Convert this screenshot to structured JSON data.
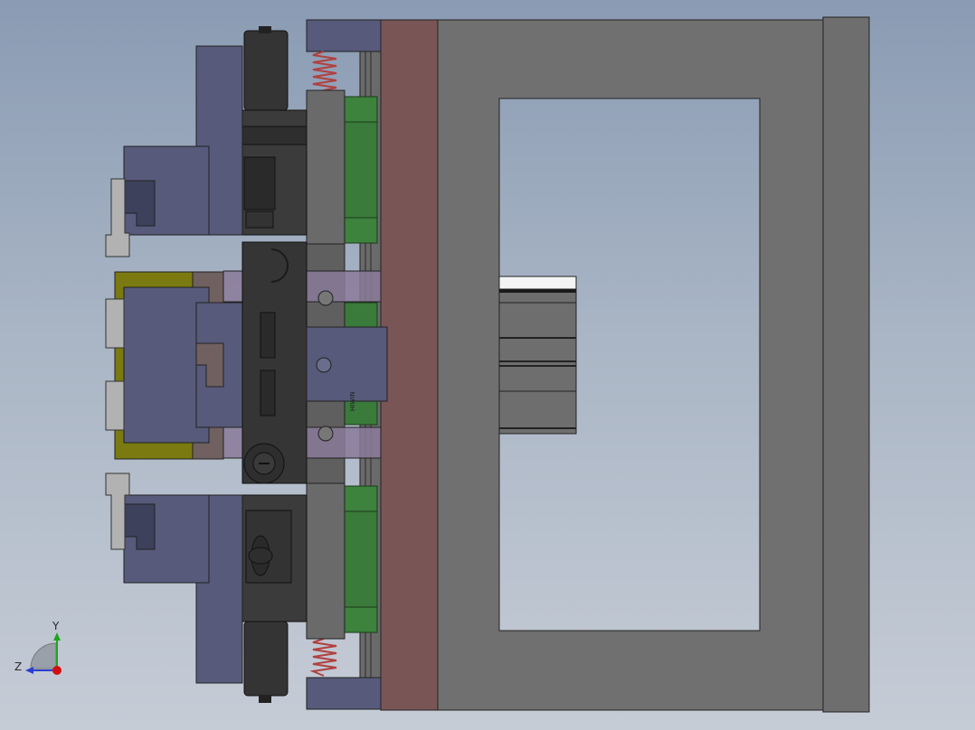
{
  "viewport": {
    "background_top": "#8a9bb3",
    "background_bottom": "#c6ccd6"
  },
  "colors": {
    "frame_gray": "#707070",
    "plate_red": "#7a5555",
    "slate_blue": "#575a7a",
    "dark_block": "#3c3c3c",
    "green_block": "#3a7a3a",
    "olive": "#7a7a10",
    "spring": "#b04040",
    "light_gray": "#b0b0b0"
  },
  "part_label": "HIWIN",
  "triad": {
    "y_label": "Y",
    "z_label": "Z",
    "y_axis_color": "#1fa51f",
    "z_axis_color": "#2a3ed0",
    "x_dot_color": "#d01010"
  }
}
